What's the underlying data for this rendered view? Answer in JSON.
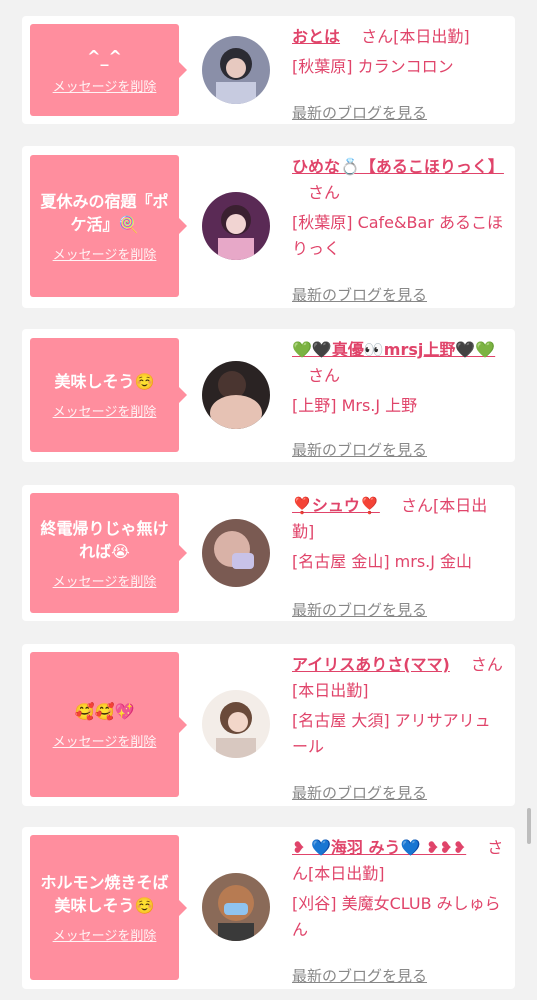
{
  "cards": [
    {
      "message": "^_^",
      "delete_label": "メッセージを削除",
      "name": "おとは",
      "san": "さん",
      "status": "[本日出勤]",
      "shop": "[秋葉原] カランコロン",
      "blog_label": "最新のブログを見る"
    },
    {
      "message": "夏休みの宿題『ポケ活』🍭",
      "delete_label": "メッセージを削除",
      "name": "ひめな💍【あるこほりっく】",
      "san": "さん",
      "status": "",
      "shop": "[秋葉原] Cafe&Bar あるこほりっく",
      "blog_label": "最新のブログを見る"
    },
    {
      "message": "美味しそう☺️",
      "delete_label": "メッセージを削除",
      "name": "💚🖤真優👀mrsj上野🖤💚",
      "san": "さん",
      "status": "",
      "shop": "[上野] Mrs.J 上野",
      "blog_label": "最新のブログを見る"
    },
    {
      "message": "終電帰りじゃ無ければ😭",
      "delete_label": "メッセージを削除",
      "name": "❣️シュウ❣️",
      "san": "さん",
      "status": "[本日出勤]",
      "shop": "[名古屋 金山] mrs.J 金山",
      "blog_label": "最新のブログを見る"
    },
    {
      "message": "🥰🥰💖",
      "delete_label": "メッセージを削除",
      "name": "アイリスありさ(ママ)",
      "san": "さん",
      "status": "[本日出勤]",
      "shop": "[名古屋 大須] アリサアリュール",
      "blog_label": "最新のブログを見る"
    },
    {
      "message": "ホルモン焼きそば美味しそう☺️",
      "delete_label": "メッセージを削除",
      "name": "❥ 💙海羽 みう💙 ❥❥❥",
      "san": "さん",
      "status": "[本日出勤]",
      "shop": "[刈谷] 美魔女CLUB みしゅらん",
      "blog_label": "最新のブログを見る"
    }
  ],
  "colors": {
    "accent": "#e0446a",
    "message_bg": "#ff8e9e",
    "page_bg": "#f2f2f2"
  }
}
